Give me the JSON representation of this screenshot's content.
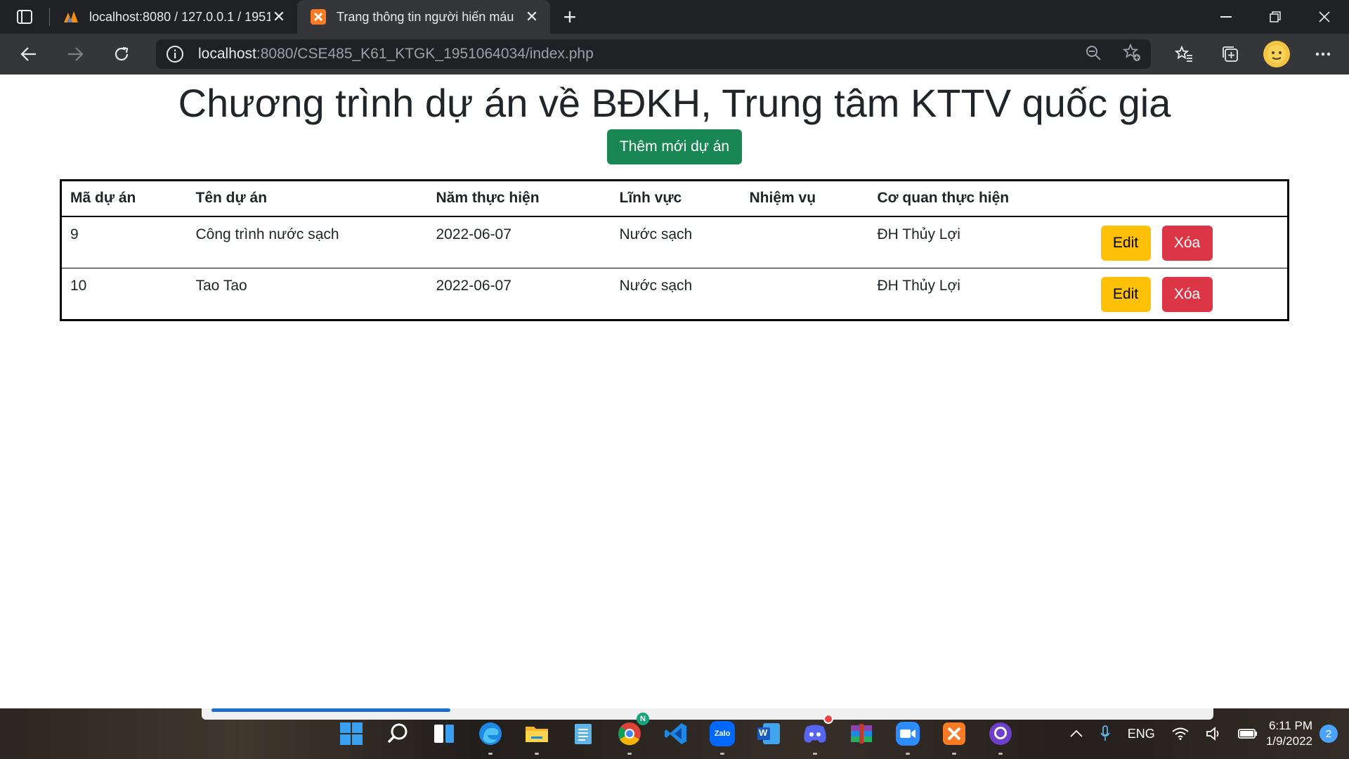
{
  "browser": {
    "tabs": [
      {
        "title": "localhost:8080 / 127.0.0.1 / 1951",
        "active": false
      },
      {
        "title": "Trang thông tin người hiến máu",
        "active": true
      }
    ],
    "url_host": "localhost",
    "url_rest": ":8080/CSE485_K61_KTGK_1951064034/index.php"
  },
  "page": {
    "title": "Chương trình dự án về BĐKH, Trung tâm KTTV quốc gia",
    "add_button": "Thêm mới dự án",
    "table": {
      "headers": [
        "Mã dự án",
        "Tên dự án",
        "Năm thực hiện",
        "Lĩnh vực",
        "Nhiệm vụ",
        "Cơ quan thực hiện",
        ""
      ],
      "rows": [
        {
          "id": "9",
          "name": "Công trình nước sạch",
          "year": "2022-06-07",
          "field": "Nước sạch",
          "task": "",
          "agency": "ĐH Thủy Lợi",
          "edit": "Edit",
          "delete": "Xóa"
        },
        {
          "id": "10",
          "name": "Tao Tao",
          "year": "2022-06-07",
          "field": "Nước sạch",
          "task": "",
          "agency": "ĐH Thủy Lợi",
          "edit": "Edit",
          "delete": "Xóa"
        }
      ]
    },
    "colors": {
      "add_button": "#198754",
      "edit_button": "#ffc107",
      "delete_button": "#dc3545"
    }
  },
  "taskbar": {
    "language": "ENG",
    "time": "6:11 PM",
    "date": "1/9/2022",
    "notifications": "2",
    "zalo_label": "Zalo",
    "word_label": "W",
    "chrome_badge": "N"
  }
}
